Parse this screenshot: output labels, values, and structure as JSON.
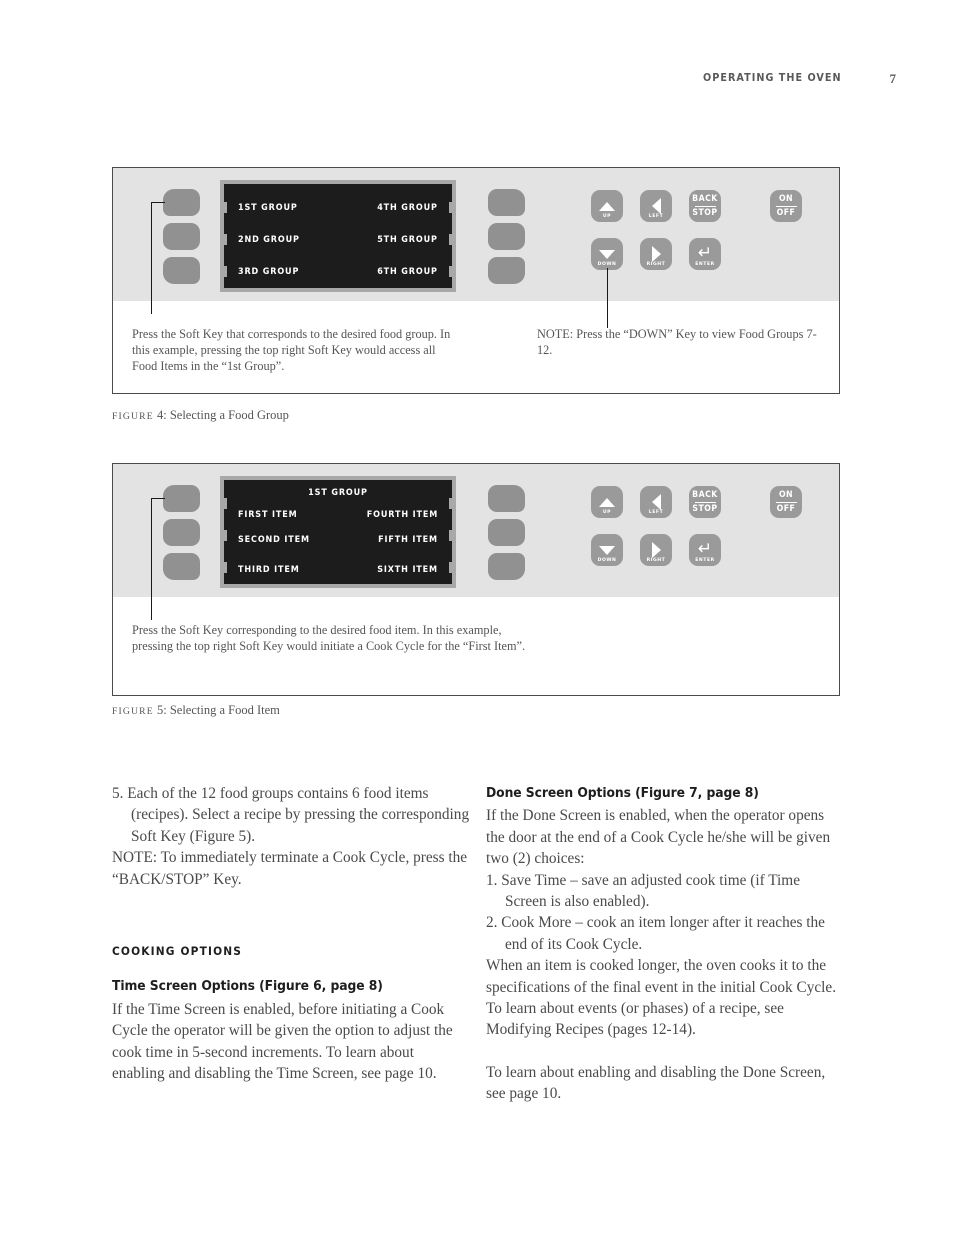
{
  "header": {
    "title": "OPERATING THE OVEN",
    "page_number": "7"
  },
  "figure_4": {
    "label_prefix": "Figure",
    "label_text": "4: Selecting a Food Group",
    "display": {
      "rows": [
        {
          "left": "1ST GROUP",
          "right": "4TH GROUP"
        },
        {
          "left": "2ND GROUP",
          "right": "5TH GROUP"
        },
        {
          "left": "3RD GROUP",
          "right": "6TH GROUP"
        }
      ]
    },
    "keys": {
      "up": "UP",
      "down": "DOWN",
      "left": "LEFT",
      "right": "RIGHT",
      "back": "BACK",
      "stop": "STOP",
      "enter": "ENTER",
      "on": "ON",
      "off": "OFF"
    },
    "caption": "Press the Soft Key that corresponds to the desired food group. In this example, pressing the top right Soft Key would access all Food Items in the “1st Group”.",
    "note": "NOTE: Press the “DOWN” Key to view Food Groups 7-12."
  },
  "figure_5": {
    "label_prefix": "Figure",
    "label_text": "5: Selecting a Food Item",
    "display": {
      "title": "1ST GROUP",
      "rows": [
        {
          "left": "FIRST ITEM",
          "right": "FOURTH ITEM"
        },
        {
          "left": "SECOND ITEM",
          "right": "FIFTH ITEM"
        },
        {
          "left": "THIRD ITEM",
          "right": "SIXTH ITEM"
        }
      ]
    },
    "keys": {
      "up": "UP",
      "down": "DOWN",
      "left": "LEFT",
      "right": "RIGHT",
      "back": "BACK",
      "stop": "STOP",
      "enter": "ENTER",
      "on": "ON",
      "off": "OFF"
    },
    "caption": "Press the Soft Key corresponding to the desired food item. In this example, pressing the top right Soft Key would initiate a Cook Cycle for the “First Item”."
  },
  "body_left": {
    "item_5": "5. Each of the 12 food groups contains 6 food items (recipes). Select a recipe by pressing the corresponding Soft Key (Figure 5).",
    "note": "NOTE: To immediately terminate a Cook Cycle, press the “BACK/STOP” Key.",
    "section_heading": "COOKING OPTIONS",
    "time_screen_heading": "Time Screen Options (Figure 6, page 8)",
    "time_screen_body": "If the Time Screen is enabled, before initiating a Cook Cycle the operator will be given the option to adjust the cook time in 5-second increments. To learn about enabling and disabling the Time Screen, see page 10."
  },
  "body_right": {
    "done_screen_heading": "Done Screen Options (Figure 7, page 8)",
    "done_screen_intro": "If the Done Screen is enabled, when the operator opens the door at the end of a Cook Cycle he/she will be given two (2) choices:",
    "choice_1": "1. Save Time – save an adjusted cook time (if Time Screen is also enabled).",
    "choice_2": "2. Cook More – cook an item longer after it reaches the end of its Cook Cycle.",
    "paragraph_2": "When an item is cooked longer, the oven cooks it to the specifications of the final event in the initial Cook Cycle. To learn about events (or phases) of a recipe, see Modifying Recipes (pages 12-14).",
    "paragraph_3": "To learn about enabling and disabling the Done Screen, see page 10."
  },
  "colors": {
    "panel_gray": "#e3e3e3",
    "key_gray": "#9a9a9a",
    "softkey_gray": "#919191",
    "lcd_black": "#1c1c1c",
    "lcd_bezel": "#a8a8a8",
    "text_gray": "#4a4a4a",
    "heading_black": "#1e1e1e"
  }
}
